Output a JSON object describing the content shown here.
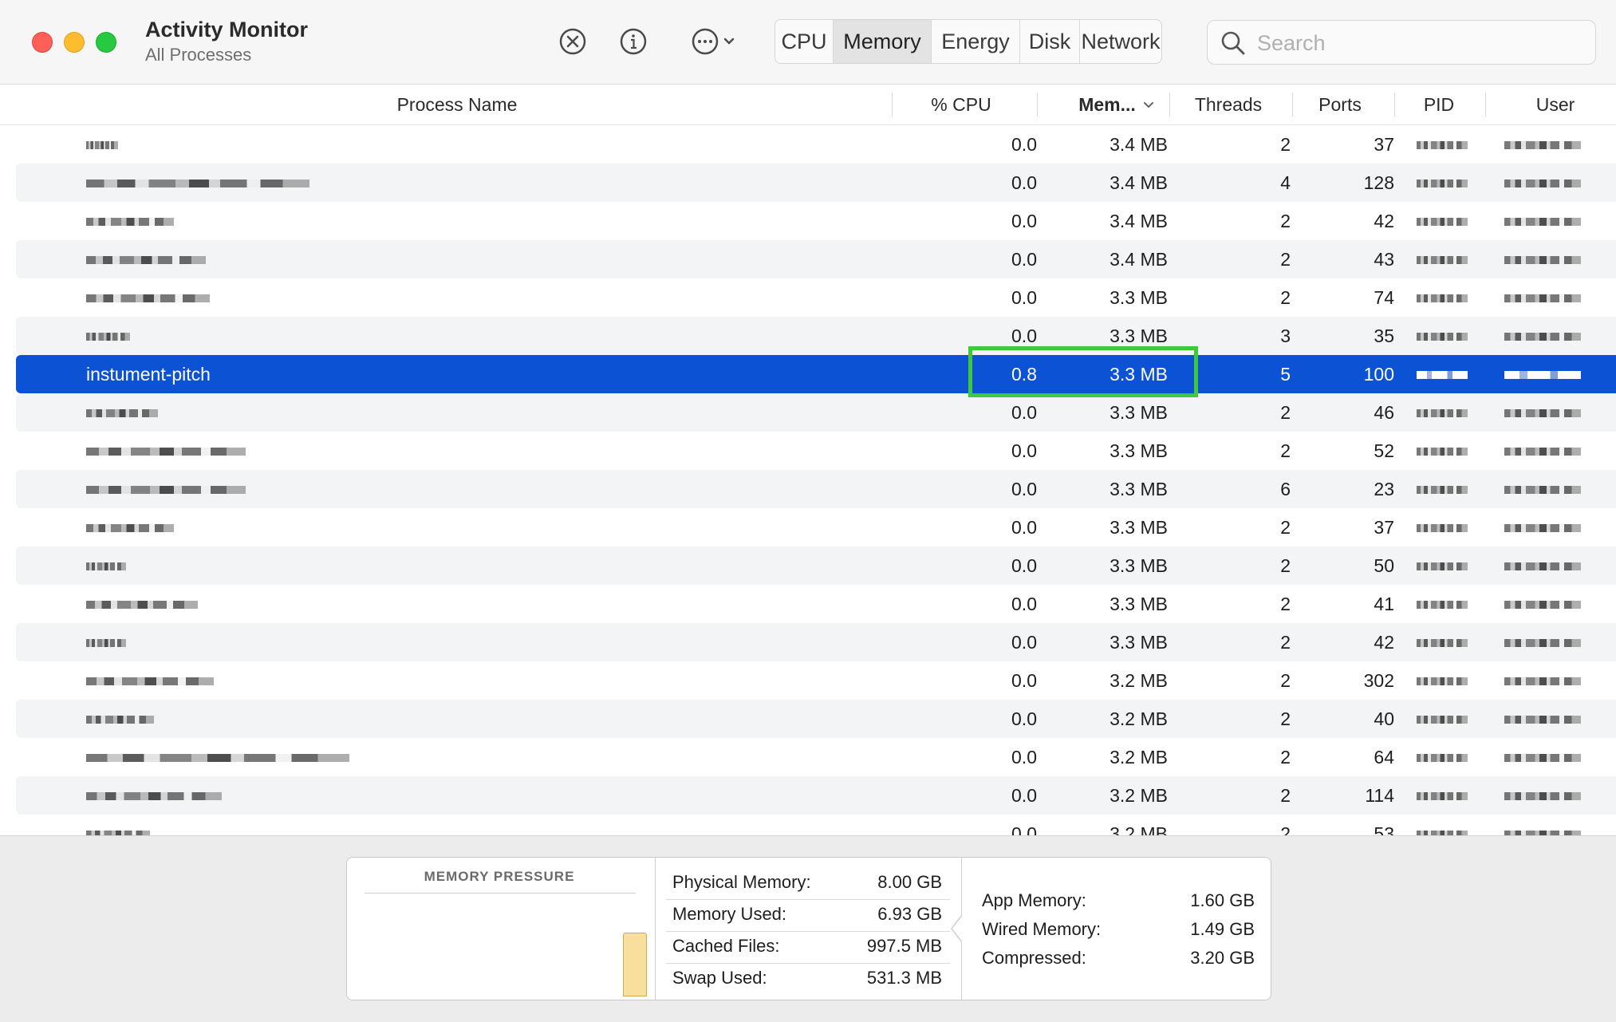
{
  "window": {
    "title": "Activity Monitor",
    "subtitle": "All Processes"
  },
  "toolbar": {
    "stop_icon": "stop-process-icon",
    "info_icon": "info-icon",
    "more_icon": "more-actions-icon",
    "tabs": [
      {
        "label": "CPU",
        "active": false
      },
      {
        "label": "Memory",
        "active": true
      },
      {
        "label": "Energy",
        "active": false
      },
      {
        "label": "Disk",
        "active": false
      },
      {
        "label": "Network",
        "active": false
      }
    ],
    "search_placeholder": "Search"
  },
  "columns": {
    "name": "Process Name",
    "cpu": "% CPU",
    "mem": "Mem...",
    "threads": "Threads",
    "ports": "Ports",
    "pid": "PID",
    "user": "User"
  },
  "rows": [
    {
      "name": "",
      "cpu": "0.0",
      "mem": "3.4 MB",
      "threads": "2",
      "ports": "37"
    },
    {
      "name": "",
      "cpu": "0.0",
      "mem": "3.4 MB",
      "threads": "4",
      "ports": "128"
    },
    {
      "name": "",
      "cpu": "0.0",
      "mem": "3.4 MB",
      "threads": "2",
      "ports": "42"
    },
    {
      "name": "",
      "cpu": "0.0",
      "mem": "3.4 MB",
      "threads": "2",
      "ports": "43"
    },
    {
      "name": "",
      "cpu": "0.0",
      "mem": "3.3 MB",
      "threads": "2",
      "ports": "74"
    },
    {
      "name": "",
      "cpu": "0.0",
      "mem": "3.3 MB",
      "threads": "3",
      "ports": "35"
    },
    {
      "name": "instument-pitch",
      "cpu": "0.8",
      "mem": "3.3 MB",
      "threads": "5",
      "ports": "100",
      "selected": true
    },
    {
      "name": "",
      "cpu": "0.0",
      "mem": "3.3 MB",
      "threads": "2",
      "ports": "46"
    },
    {
      "name": "",
      "cpu": "0.0",
      "mem": "3.3 MB",
      "threads": "2",
      "ports": "52"
    },
    {
      "name": "",
      "cpu": "0.0",
      "mem": "3.3 MB",
      "threads": "6",
      "ports": "23"
    },
    {
      "name": "",
      "cpu": "0.0",
      "mem": "3.3 MB",
      "threads": "2",
      "ports": "37"
    },
    {
      "name": "",
      "cpu": "0.0",
      "mem": "3.3 MB",
      "threads": "2",
      "ports": "50"
    },
    {
      "name": "",
      "cpu": "0.0",
      "mem": "3.3 MB",
      "threads": "2",
      "ports": "41"
    },
    {
      "name": "",
      "cpu": "0.0",
      "mem": "3.3 MB",
      "threads": "2",
      "ports": "42"
    },
    {
      "name": "",
      "cpu": "0.0",
      "mem": "3.2 MB",
      "threads": "2",
      "ports": "302"
    },
    {
      "name": "",
      "cpu": "0.0",
      "mem": "3.2 MB",
      "threads": "2",
      "ports": "40"
    },
    {
      "name": "",
      "cpu": "0.0",
      "mem": "3.2 MB",
      "threads": "2",
      "ports": "64"
    },
    {
      "name": "",
      "cpu": "0.0",
      "mem": "3.2 MB",
      "threads": "2",
      "ports": "114"
    },
    {
      "name": "",
      "cpu": "0.0",
      "mem": "3.2 MB",
      "threads": "2",
      "ports": "53"
    }
  ],
  "footer": {
    "pressure_title": "MEMORY PRESSURE",
    "stats_left": [
      {
        "label": "Physical Memory:",
        "value": "8.00 GB"
      },
      {
        "label": "Memory Used:",
        "value": "6.93 GB"
      },
      {
        "label": "Cached Files:",
        "value": "997.5 MB"
      },
      {
        "label": "Swap Used:",
        "value": "531.3 MB"
      }
    ],
    "stats_right": [
      {
        "label": "App Memory:",
        "value": "1.60 GB"
      },
      {
        "label": "Wired Memory:",
        "value": "1.49 GB"
      },
      {
        "label": "Compressed:",
        "value": "3.20 GB"
      }
    ]
  },
  "colors": {
    "selection": "#0b52d5",
    "highlight_box": "#3cc93c",
    "pressure_fill": "#f9df9e"
  }
}
